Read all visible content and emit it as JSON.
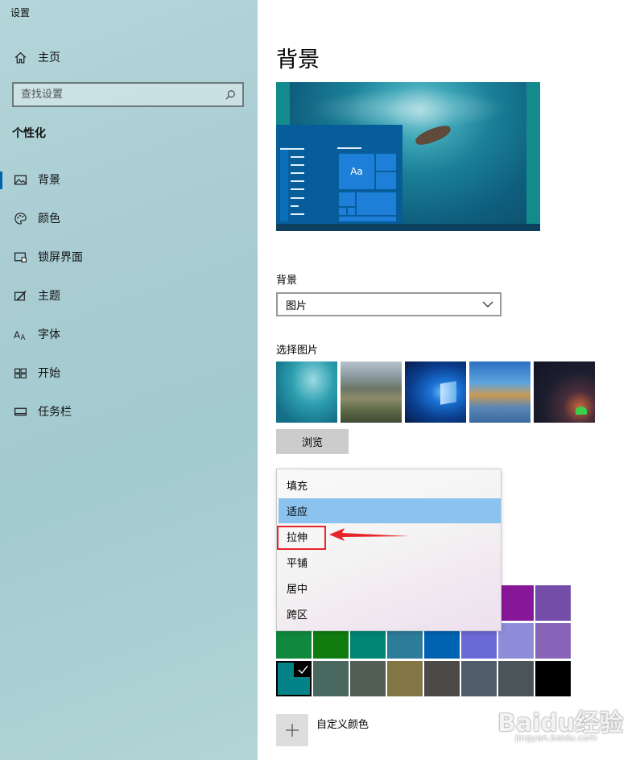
{
  "window": {
    "title": "设置"
  },
  "sidebar": {
    "home_label": "主页",
    "search_placeholder": "查找设置",
    "section_title": "个性化",
    "items": [
      {
        "label": "背景",
        "icon": "picture-icon",
        "active": true
      },
      {
        "label": "颜色",
        "icon": "palette-icon",
        "active": false
      },
      {
        "label": "锁屏界面",
        "icon": "lockscreen-icon",
        "active": false
      },
      {
        "label": "主题",
        "icon": "theme-icon",
        "active": false
      },
      {
        "label": "字体",
        "icon": "font-icon",
        "active": false
      },
      {
        "label": "开始",
        "icon": "start-icon",
        "active": false
      },
      {
        "label": "任务栏",
        "icon": "taskbar-icon",
        "active": false
      }
    ]
  },
  "main": {
    "page_title": "背景",
    "preview": {
      "tile_label": "Aa"
    },
    "background_label": "背景",
    "background_value": "图片",
    "choose_picture_label": "选择图片",
    "browse_label": "浏览",
    "fit_menu": {
      "options": [
        "填充",
        "适应",
        "拉伸",
        "平铺",
        "居中",
        "跨区"
      ],
      "selected": "适应",
      "annotated": "拉伸"
    },
    "color_rows": [
      [
        "#881798",
        "#744da9"
      ],
      [
        "#10893e",
        "#107c10",
        "#018574",
        "#2d7d9a",
        "#0063b1",
        "#6b69d6",
        "#8e8cd8",
        "#8764b8"
      ],
      [
        "#038387",
        "#486860",
        "#525e54",
        "#847545",
        "#4c4a48",
        "#515c6b",
        "#4a5459",
        "#000000"
      ]
    ],
    "selected_color": "#038387",
    "custom_color_label": "自定义颜色"
  },
  "watermark": {
    "brand": "Baidu经验",
    "url": "jingyan.baidu.com"
  },
  "colors": {
    "accent": "#0063b1",
    "menu_selected": "#8bc2ee",
    "annotation": "#e8252b"
  }
}
